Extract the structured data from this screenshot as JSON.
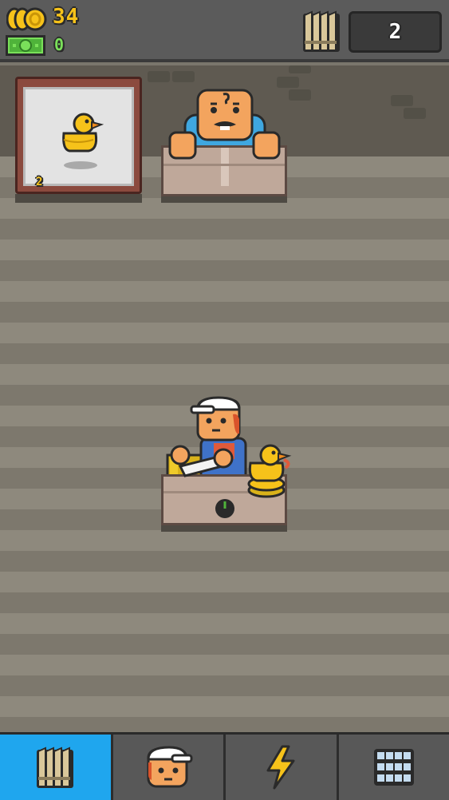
{
  "hud": {
    "coins": "34",
    "cash": "0",
    "packs": "2"
  },
  "display_case": {
    "item_icon": "rubber-duck-icon",
    "count": "2"
  },
  "navigation": {
    "tabs": [
      {
        "icon": "card-packs-icon",
        "active": true
      },
      {
        "icon": "worker-icon",
        "active": false
      },
      {
        "icon": "lightning-icon",
        "active": false
      },
      {
        "icon": "grid-icon",
        "active": false
      }
    ]
  },
  "colors": {
    "coin": "#f6c21a",
    "cash": "#7ae05a",
    "active_tab": "#1fa6ee"
  }
}
